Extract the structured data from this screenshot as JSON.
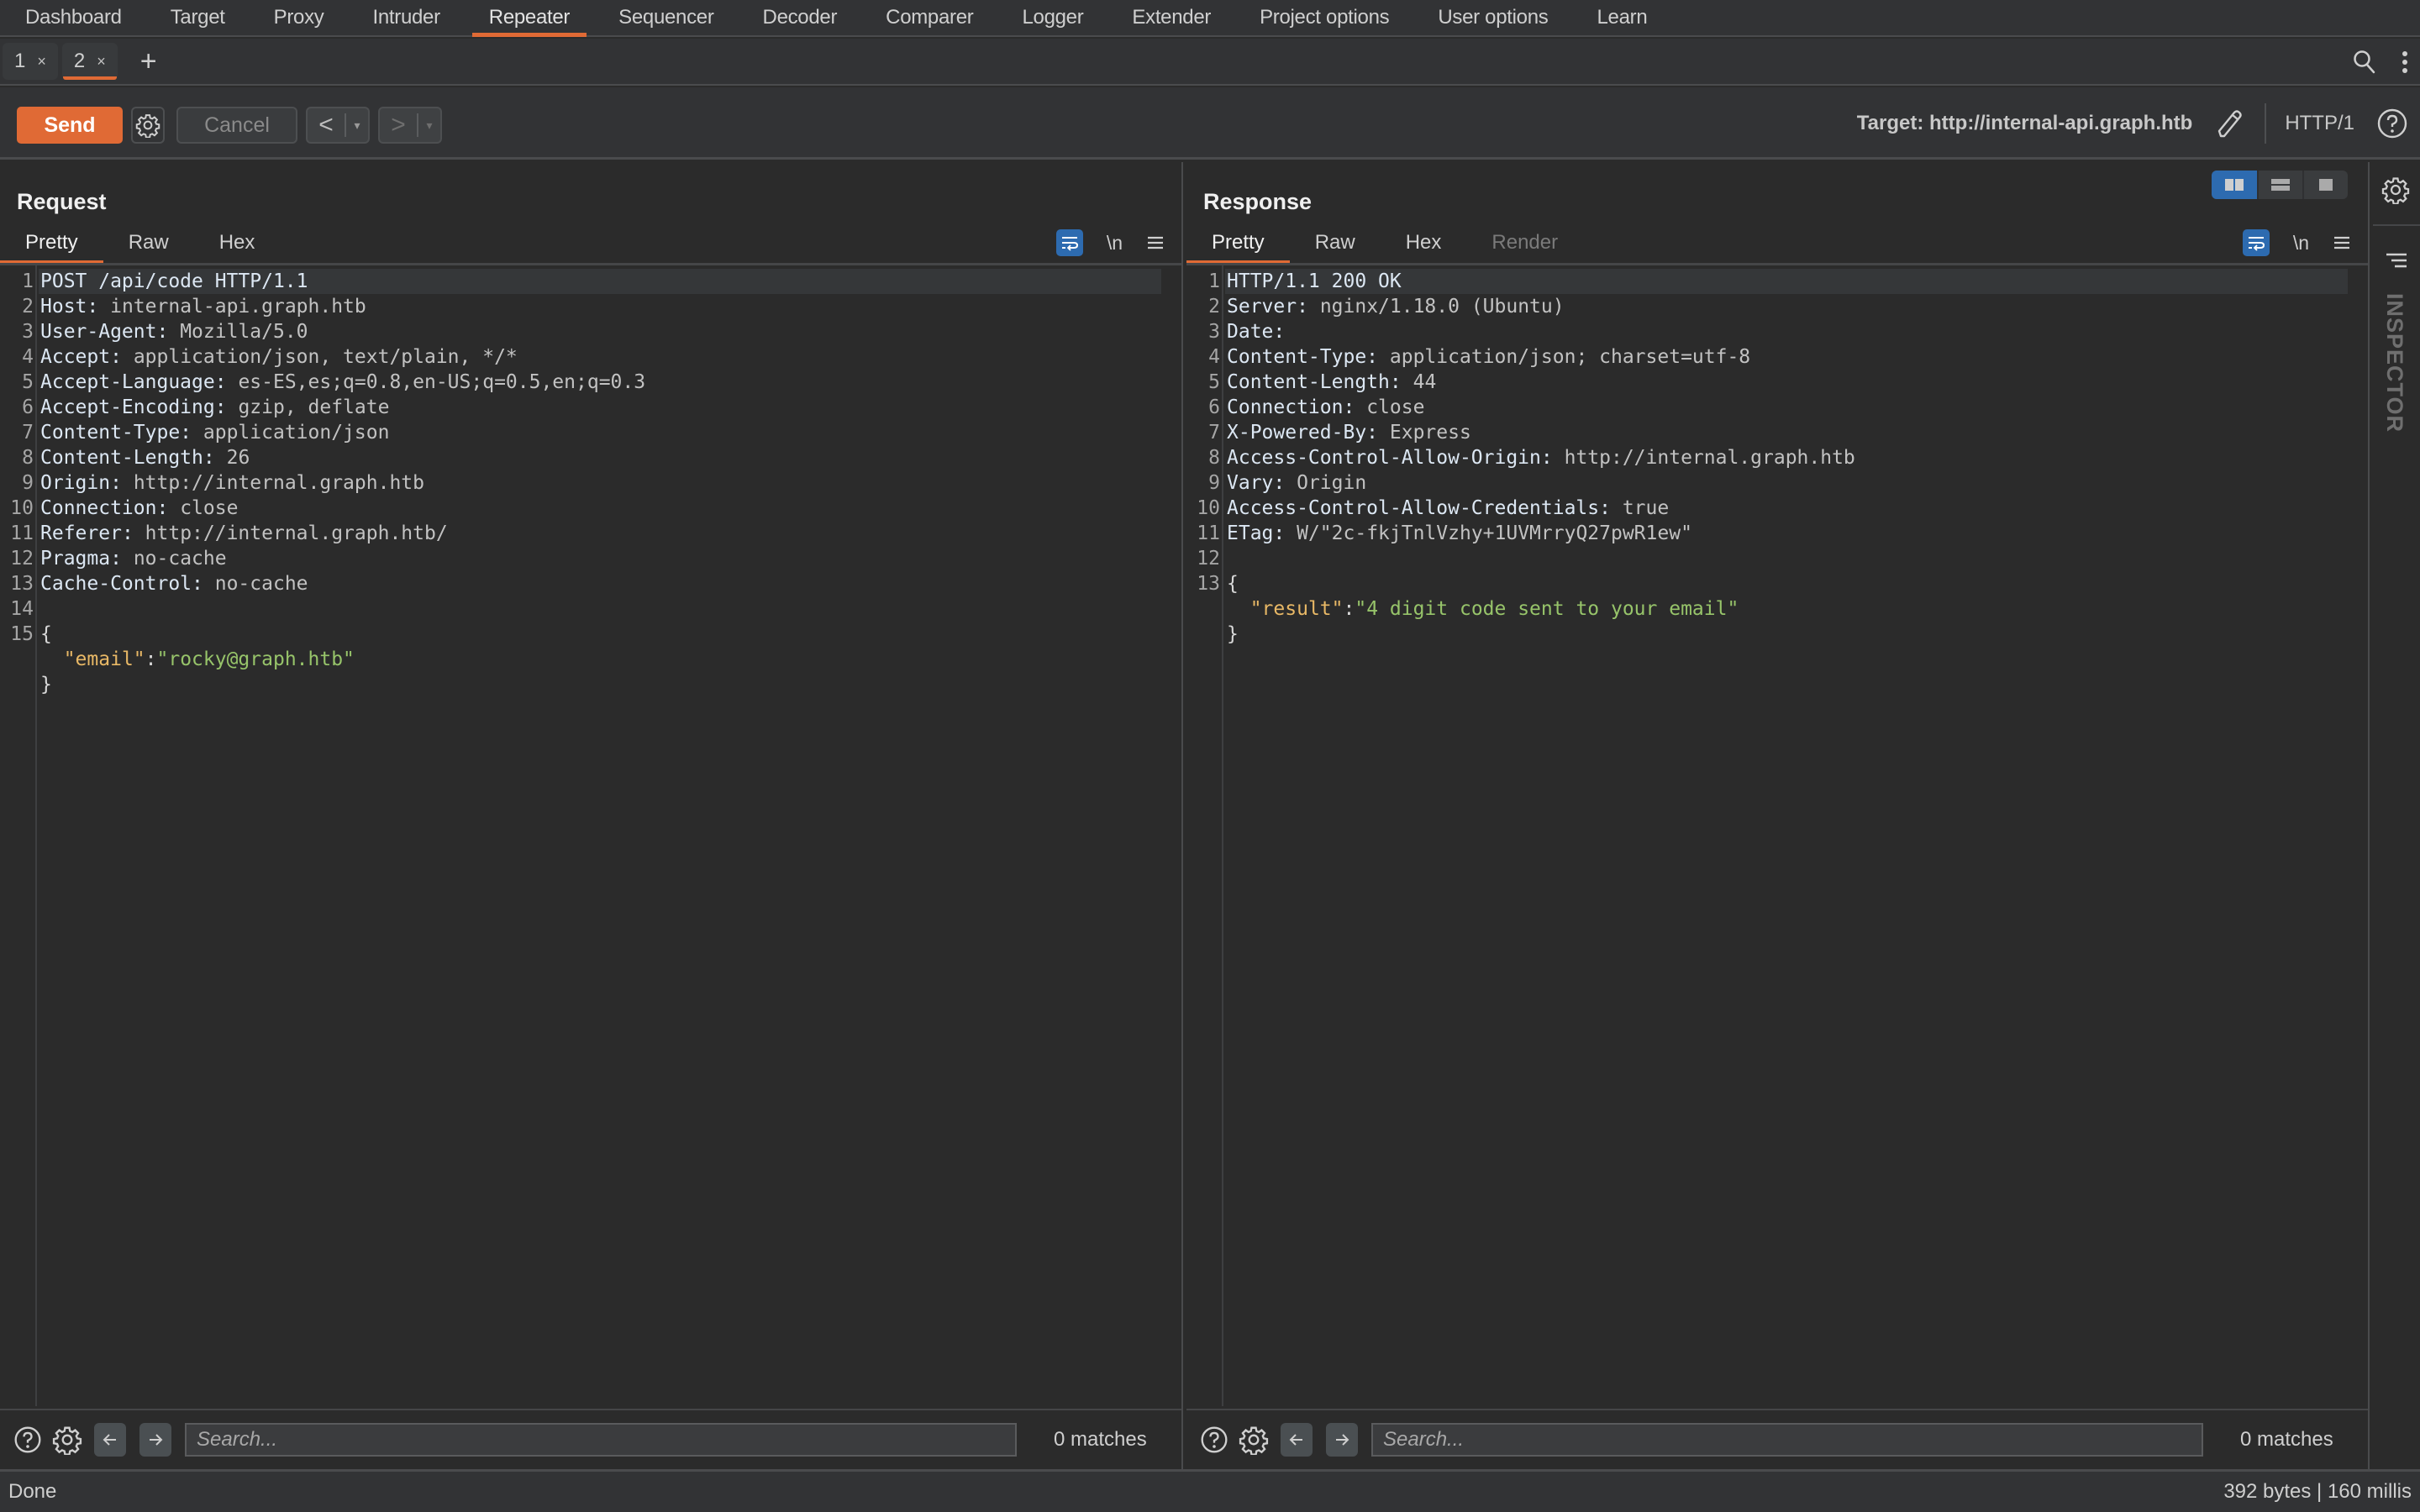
{
  "menu": {
    "items": [
      {
        "label": "Dashboard",
        "active": false
      },
      {
        "label": "Target",
        "active": false
      },
      {
        "label": "Proxy",
        "active": false
      },
      {
        "label": "Intruder",
        "active": false
      },
      {
        "label": "Repeater",
        "active": true
      },
      {
        "label": "Sequencer",
        "active": false
      },
      {
        "label": "Decoder",
        "active": false
      },
      {
        "label": "Comparer",
        "active": false
      },
      {
        "label": "Logger",
        "active": false
      },
      {
        "label": "Extender",
        "active": false
      },
      {
        "label": "Project options",
        "active": false
      },
      {
        "label": "User options",
        "active": false
      },
      {
        "label": "Learn",
        "active": false
      }
    ]
  },
  "repeater_tabs": {
    "tabs": [
      {
        "label": "1",
        "close": "×",
        "active": false
      },
      {
        "label": "2",
        "close": "×",
        "active": true
      }
    ],
    "add_label": "+",
    "search_icon": "search-icon",
    "more_icon": "more-vertical-icon"
  },
  "toolbar": {
    "send_label": "Send",
    "cancel_label": "Cancel",
    "back_label": "<",
    "forward_label": ">",
    "dropdown_glyph": "▾",
    "target_label": "Target: http://internal-api.graph.htb",
    "http_version": "HTTP/1"
  },
  "request": {
    "title": "Request",
    "tabs": [
      {
        "label": "Pretty",
        "active": true,
        "disabled": false
      },
      {
        "label": "Raw",
        "active": false,
        "disabled": false
      },
      {
        "label": "Hex",
        "active": false,
        "disabled": false
      }
    ],
    "newline_label": "\\n",
    "lines": [
      {
        "num": "1",
        "type": "first",
        "text": "POST /api/code HTTP/1.1"
      },
      {
        "num": "2",
        "type": "header",
        "name": "Host",
        "value": "internal-api.graph.htb"
      },
      {
        "num": "3",
        "type": "header",
        "name": "User-Agent",
        "value": "Mozilla/5.0"
      },
      {
        "num": "4",
        "type": "header",
        "name": "Accept",
        "value": "application/json, text/plain, */*"
      },
      {
        "num": "5",
        "type": "header",
        "name": "Accept-Language",
        "value": "es-ES,es;q=0.8,en-US;q=0.5,en;q=0.3"
      },
      {
        "num": "6",
        "type": "header",
        "name": "Accept-Encoding",
        "value": "gzip, deflate"
      },
      {
        "num": "7",
        "type": "header",
        "name": "Content-Type",
        "value": "application/json"
      },
      {
        "num": "8",
        "type": "header",
        "name": "Content-Length",
        "value": "26"
      },
      {
        "num": "9",
        "type": "header",
        "name": "Origin",
        "value": "http://internal.graph.htb"
      },
      {
        "num": "10",
        "type": "header",
        "name": "Connection",
        "value": "close"
      },
      {
        "num": "11",
        "type": "header",
        "name": "Referer",
        "value": "http://internal.graph.htb/"
      },
      {
        "num": "12",
        "type": "header",
        "name": "Pragma",
        "value": "no-cache"
      },
      {
        "num": "13",
        "type": "header",
        "name": "Cache-Control",
        "value": "no-cache"
      },
      {
        "num": "14",
        "type": "blank",
        "text": ""
      },
      {
        "num": "15",
        "type": "punct",
        "text": "{"
      },
      {
        "num": "",
        "type": "json",
        "key": "\"email\"",
        "value": "\"rocky@graph.htb\""
      },
      {
        "num": "",
        "type": "punct",
        "text": "}"
      }
    ],
    "search": {
      "placeholder": "Search...",
      "value": "",
      "matches": "0 matches"
    }
  },
  "response": {
    "title": "Response",
    "tabs": [
      {
        "label": "Pretty",
        "active": true,
        "disabled": false
      },
      {
        "label": "Raw",
        "active": false,
        "disabled": false
      },
      {
        "label": "Hex",
        "active": false,
        "disabled": false
      },
      {
        "label": "Render",
        "active": false,
        "disabled": true
      }
    ],
    "newline_label": "\\n",
    "lines": [
      {
        "num": "1",
        "type": "first",
        "text": "HTTP/1.1 200 OK"
      },
      {
        "num": "2",
        "type": "header",
        "name": "Server",
        "value": "nginx/1.18.0 (Ubuntu)"
      },
      {
        "num": "3",
        "type": "header",
        "name": "Date",
        "value": ""
      },
      {
        "num": "4",
        "type": "header",
        "name": "Content-Type",
        "value": "application/json; charset=utf-8"
      },
      {
        "num": "5",
        "type": "header",
        "name": "Content-Length",
        "value": "44"
      },
      {
        "num": "6",
        "type": "header",
        "name": "Connection",
        "value": "close"
      },
      {
        "num": "7",
        "type": "header",
        "name": "X-Powered-By",
        "value": "Express"
      },
      {
        "num": "8",
        "type": "header",
        "name": "Access-Control-Allow-Origin",
        "value": "http://internal.graph.htb"
      },
      {
        "num": "9",
        "type": "header",
        "name": "Vary",
        "value": "Origin"
      },
      {
        "num": "10",
        "type": "header",
        "name": "Access-Control-Allow-Credentials",
        "value": "true"
      },
      {
        "num": "11",
        "type": "header",
        "name": "ETag",
        "value": "W/\"2c-fkjTnlVzhy+1UVMrryQ27pwR1ew\""
      },
      {
        "num": "12",
        "type": "blank",
        "text": ""
      },
      {
        "num": "13",
        "type": "punct",
        "text": "{"
      },
      {
        "num": "",
        "type": "json",
        "key": "\"result\"",
        "value": "\"4 digit code sent to your email\""
      },
      {
        "num": "",
        "type": "punct",
        "text": "}"
      }
    ],
    "search": {
      "placeholder": "Search...",
      "value": "",
      "matches": "0 matches"
    }
  },
  "inspector": {
    "label": "INSPECTOR"
  },
  "layout_toggle": {
    "options": [
      "side-by-side",
      "top-bottom",
      "single"
    ],
    "active": "side-by-side"
  },
  "status": {
    "left": "Done",
    "right": "392 bytes | 160 millis"
  },
  "colors": {
    "accent": "#e06a35",
    "toggle_active": "#2d6bb0",
    "json_key": "#e8b866",
    "json_string": "#97c46a"
  }
}
